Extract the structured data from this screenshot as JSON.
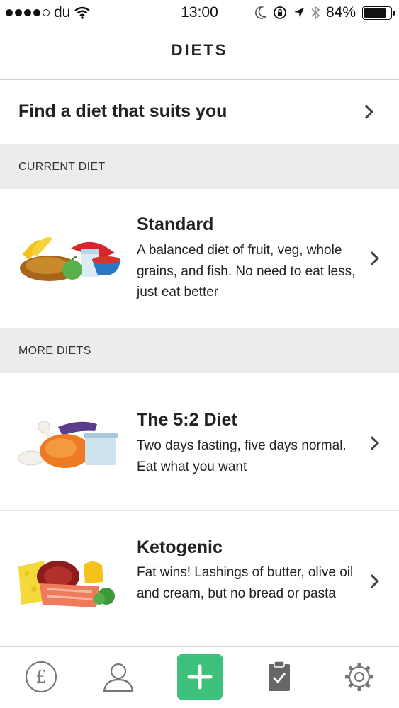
{
  "status": {
    "carrier": "du",
    "time": "13:00",
    "battery_text": "84%",
    "battery_level": 0.84
  },
  "nav": {
    "title": "DIETS"
  },
  "find": {
    "label": "Find a diet that suits you"
  },
  "sections": {
    "current": "CURRENT DIET",
    "more": "MORE DIETS"
  },
  "diets": [
    {
      "title": "Standard",
      "description": "A balanced diet of fruit, veg, whole grains, and fish. No need to eat less, just eat better"
    },
    {
      "title": "The 5:2 Diet",
      "description": "Two days fasting, five days normal. Eat what you want"
    },
    {
      "title": "Ketogenic",
      "description": "Fat wins! Lashings of butter, olive oil and cream, but no bread or pasta"
    }
  ],
  "tabs": [
    {
      "name": "pound",
      "icon": "pound-coin-icon"
    },
    {
      "name": "profile",
      "icon": "person-icon"
    },
    {
      "name": "add",
      "icon": "plus-icon"
    },
    {
      "name": "log",
      "icon": "clipboard-check-icon"
    },
    {
      "name": "settings",
      "icon": "gear-icon"
    }
  ],
  "colors": {
    "accent": "#3cc27a",
    "section_bg": "#ececea",
    "text": "#222222"
  }
}
